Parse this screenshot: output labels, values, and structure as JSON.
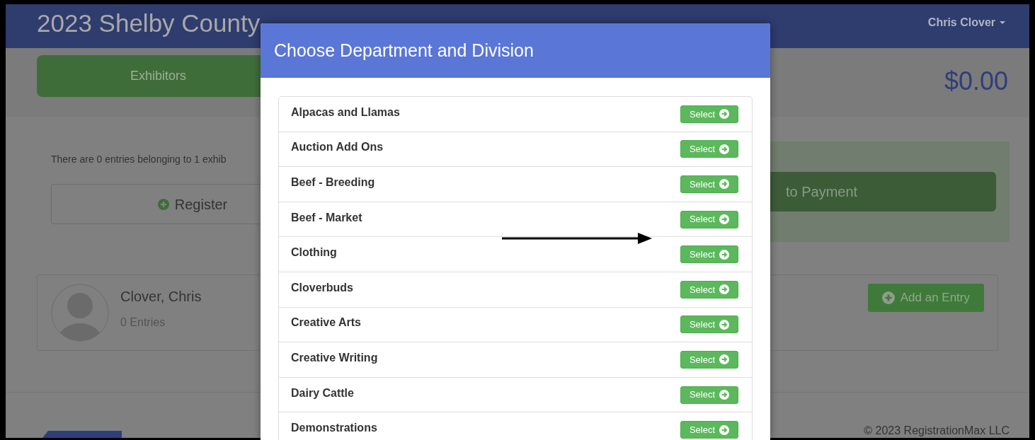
{
  "header": {
    "title": "2023 Shelby County",
    "user_menu": "Chris Clover"
  },
  "nav": {
    "exhibitors_tab": "Exhibitors",
    "total": "$0.00"
  },
  "summary": {
    "text": "There are 0 entries belonging to 1 exhib",
    "register_button": "Register",
    "payment_button": "to Payment"
  },
  "exhibitor": {
    "name": "Clover, Chris",
    "entries": "0 Entries",
    "add_button": "Add an Entry"
  },
  "footer": {
    "copyright": "© 2023 RegistrationMax LLC"
  },
  "modal": {
    "title": "Choose Department and Division",
    "departments": [
      {
        "name": "Alpacas and Llamas",
        "button": "Select"
      },
      {
        "name": "Auction Add Ons",
        "button": "Select"
      },
      {
        "name": "Beef - Breeding",
        "button": "Select"
      },
      {
        "name": "Beef - Market",
        "button": "Select"
      },
      {
        "name": "Clothing",
        "button": "Select"
      },
      {
        "name": "Cloverbuds",
        "button": "Select"
      },
      {
        "name": "Creative Arts",
        "button": "Select"
      },
      {
        "name": "Creative Writing",
        "button": "Select"
      },
      {
        "name": "Dairy Cattle",
        "button": "Select"
      },
      {
        "name": "Demonstrations",
        "button": "Select"
      }
    ]
  }
}
